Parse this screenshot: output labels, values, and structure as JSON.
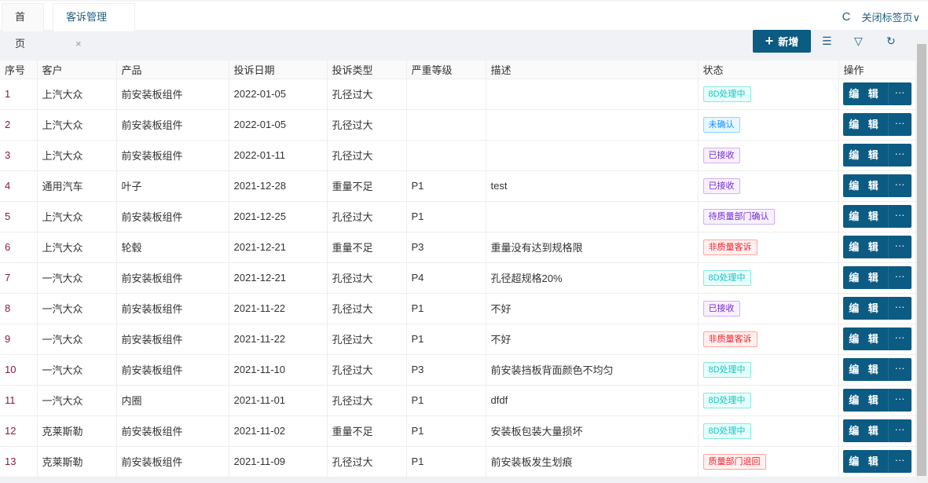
{
  "tabs": {
    "home": "首页",
    "active": "客诉管理",
    "close": "×",
    "refresh": "C",
    "close_tabs": "关闭标签页∨"
  },
  "toolbar": {
    "add": "新增",
    "add_icon": "+",
    "columns_icon": "☰",
    "filter_icon": "▽",
    "refresh_icon": "↻"
  },
  "columns": [
    "序号",
    "客户",
    "产品",
    "投诉日期",
    "投诉类型",
    "严重等级",
    "描述",
    "状态",
    "操作"
  ],
  "ops": {
    "edit": "编 辑",
    "more": "···"
  },
  "colors": {
    "primary": "#0c5b82"
  },
  "rows": [
    {
      "no": "1",
      "customer": "上汽大众",
      "product": "前安装板组件",
      "date": "2022-01-05",
      "type": "孔径过大",
      "level": "",
      "desc": "",
      "status": "8D处理中",
      "st": "cyan"
    },
    {
      "no": "2",
      "customer": "上汽大众",
      "product": "前安装板组件",
      "date": "2022-01-05",
      "type": "孔径过大",
      "level": "",
      "desc": "",
      "status": "未确认",
      "st": "blue"
    },
    {
      "no": "3",
      "customer": "上汽大众",
      "product": "前安装板组件",
      "date": "2022-01-11",
      "type": "孔径过大",
      "level": "",
      "desc": "",
      "status": "已接收",
      "st": "purple"
    },
    {
      "no": "4",
      "customer": "通用汽车",
      "product": "叶子",
      "date": "2021-12-28",
      "type": "重量不足",
      "level": "P1",
      "desc": "test",
      "status": "已接收",
      "st": "purple"
    },
    {
      "no": "5",
      "customer": "上汽大众",
      "product": "前安装板组件",
      "date": "2021-12-25",
      "type": "孔径过大",
      "level": "P1",
      "desc": "",
      "status": "待质量部门确认",
      "st": "purple"
    },
    {
      "no": "6",
      "customer": "上汽大众",
      "product": "轮毂",
      "date": "2021-12-21",
      "type": "重量不足",
      "level": "P3",
      "desc": "重量没有达到规格限",
      "status": "非质量客诉",
      "st": "red"
    },
    {
      "no": "7",
      "customer": "一汽大众",
      "product": "前安装板组件",
      "date": "2021-12-21",
      "type": "孔径过大",
      "level": "P4",
      "desc": "孔径超规格20%",
      "status": "8D处理中",
      "st": "cyan"
    },
    {
      "no": "8",
      "customer": "一汽大众",
      "product": "前安装板组件",
      "date": "2021-11-22",
      "type": "孔径过大",
      "level": "P1",
      "desc": "不好",
      "status": "已接收",
      "st": "purple"
    },
    {
      "no": "9",
      "customer": "一汽大众",
      "product": "前安装板组件",
      "date": "2021-11-22",
      "type": "孔径过大",
      "level": "P1",
      "desc": "不好",
      "status": "非质量客诉",
      "st": "red"
    },
    {
      "no": "10",
      "customer": "一汽大众",
      "product": "前安装板组件",
      "date": "2021-11-10",
      "type": "孔径过大",
      "level": "P3",
      "desc": "前安装挡板背面颜色不均匀",
      "status": "8D处理中",
      "st": "cyan"
    },
    {
      "no": "11",
      "customer": "一汽大众",
      "product": "内圈",
      "date": "2021-11-01",
      "type": "孔径过大",
      "level": "P1",
      "desc": "dfdf",
      "status": "8D处理中",
      "st": "cyan"
    },
    {
      "no": "12",
      "customer": "克莱斯勒",
      "product": "前安装板组件",
      "date": "2021-11-02",
      "type": "重量不足",
      "level": "P1",
      "desc": "安装板包装大量损坏",
      "status": "8D处理中",
      "st": "cyan"
    },
    {
      "no": "13",
      "customer": "克莱斯勒",
      "product": "前安装板组件",
      "date": "2021-11-09",
      "type": "孔径过大",
      "level": "P1",
      "desc": "前安装板发生划痕",
      "status": "质量部门退回",
      "st": "red"
    }
  ]
}
